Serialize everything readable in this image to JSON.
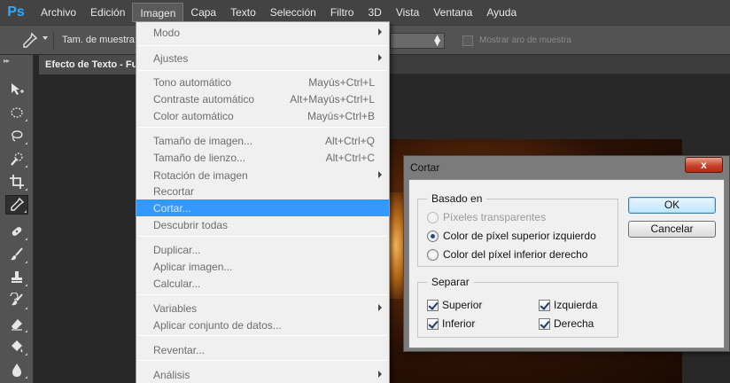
{
  "app": {
    "logo": "Ps",
    "menu": [
      "Archivo",
      "Edición",
      "Imagen",
      "Capa",
      "Texto",
      "Selección",
      "Filtro",
      "3D",
      "Vista",
      "Ventana",
      "Ayuda"
    ],
    "active_menu": "Imagen"
  },
  "options_bar": {
    "sample_label": "Tam. de muestra:",
    "ring_label": "Mostrar aro de muestra"
  },
  "document": {
    "tab_title": "Efecto de Texto - Fu"
  },
  "image_menu": {
    "items": [
      {
        "label": "Modo",
        "shortcut": "",
        "submenu": true
      },
      {
        "label": "Ajustes",
        "shortcut": "",
        "submenu": true
      },
      {
        "label": "Tono automático",
        "shortcut": "Mayús+Ctrl+L",
        "submenu": false
      },
      {
        "label": "Contraste automático",
        "shortcut": "Alt+Mayús+Ctrl+L",
        "submenu": false
      },
      {
        "label": "Color automático",
        "shortcut": "Mayús+Ctrl+B",
        "submenu": false
      },
      {
        "label": "Tamaño de imagen...",
        "shortcut": "Alt+Ctrl+Q",
        "submenu": false
      },
      {
        "label": "Tamaño de lienzo...",
        "shortcut": "Alt+Ctrl+C",
        "submenu": false
      },
      {
        "label": "Rotación de imagen",
        "shortcut": "",
        "submenu": true
      },
      {
        "label": "Recortar",
        "shortcut": "",
        "submenu": false
      },
      {
        "label": "Cortar...",
        "shortcut": "",
        "submenu": false,
        "highlighted": true
      },
      {
        "label": "Descubrir todas",
        "shortcut": "",
        "submenu": false
      },
      {
        "label": "Duplicar...",
        "shortcut": "",
        "submenu": false
      },
      {
        "label": "Aplicar imagen...",
        "shortcut": "",
        "submenu": false
      },
      {
        "label": "Calcular...",
        "shortcut": "",
        "submenu": false
      },
      {
        "label": "Variables",
        "shortcut": "",
        "submenu": true
      },
      {
        "label": "Aplicar conjunto de datos...",
        "shortcut": "",
        "submenu": false
      },
      {
        "label": "Reventar...",
        "shortcut": "",
        "submenu": false
      },
      {
        "label": "Análisis",
        "shortcut": "",
        "submenu": true
      }
    ]
  },
  "dialog": {
    "title": "Cortar",
    "close_label": "x",
    "based_on": {
      "legend": "Basado en",
      "options": [
        {
          "label": "Píxeles transparentes",
          "selected": false,
          "disabled": true
        },
        {
          "label": "Color de píxel superior izquierdo",
          "selected": true,
          "disabled": false
        },
        {
          "label": "Color del píxel inferior derecho",
          "selected": false,
          "disabled": false
        }
      ]
    },
    "separate": {
      "legend": "Separar",
      "top_label": "Superior",
      "bottom_label": "Inferior",
      "left_label": "Izquierda",
      "right_label": "Derecha",
      "top_checked": true,
      "bottom_checked": true,
      "left_checked": true,
      "right_checked": true
    },
    "ok_label": "OK",
    "cancel_label": "Cancelar"
  },
  "colors": {
    "highlight": "#3399ff",
    "menubar": "#434343",
    "panel": "#535353"
  }
}
